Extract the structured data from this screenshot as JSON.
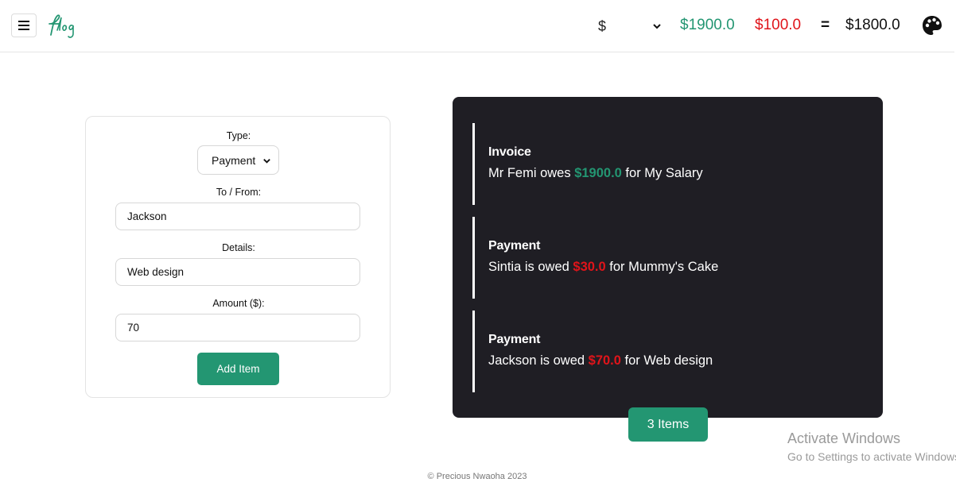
{
  "header": {
    "menu_icon": "hamburger-icon",
    "logo_text": "flog",
    "currency": "$",
    "total_in": "$1900.0",
    "total_out": "$100.0",
    "equals": "=",
    "total_net": "$1800.0",
    "theme_icon": "palette-icon",
    "colors": {
      "income": "#239672",
      "expense": "#e0141a"
    }
  },
  "form": {
    "type_label": "Type:",
    "type_value": "Payment",
    "to_from_label": "To / From:",
    "to_from_value": "Jackson",
    "details_label": "Details:",
    "details_value": "Web design",
    "amount_label": "Amount ($):",
    "amount_value": "70",
    "submit_label": "Add Item"
  },
  "items": [
    {
      "type": "Invoice",
      "pre": "Mr Femi owes ",
      "amount": "$1900.0",
      "post": " for My Salary"
    },
    {
      "type": "Payment",
      "pre": "Sintia is owed ",
      "amount": "$30.0",
      "post": " for Mummy's Cake"
    },
    {
      "type": "Payment",
      "pre": "Jackson is owed ",
      "amount": "$70.0",
      "post": " for Web design"
    }
  ],
  "item_count": "3 Items",
  "watermark": {
    "title": "Activate Windows",
    "subtitle": "Go to Settings to activate Windows."
  },
  "footer": "© Precious Nwaoha 2023"
}
